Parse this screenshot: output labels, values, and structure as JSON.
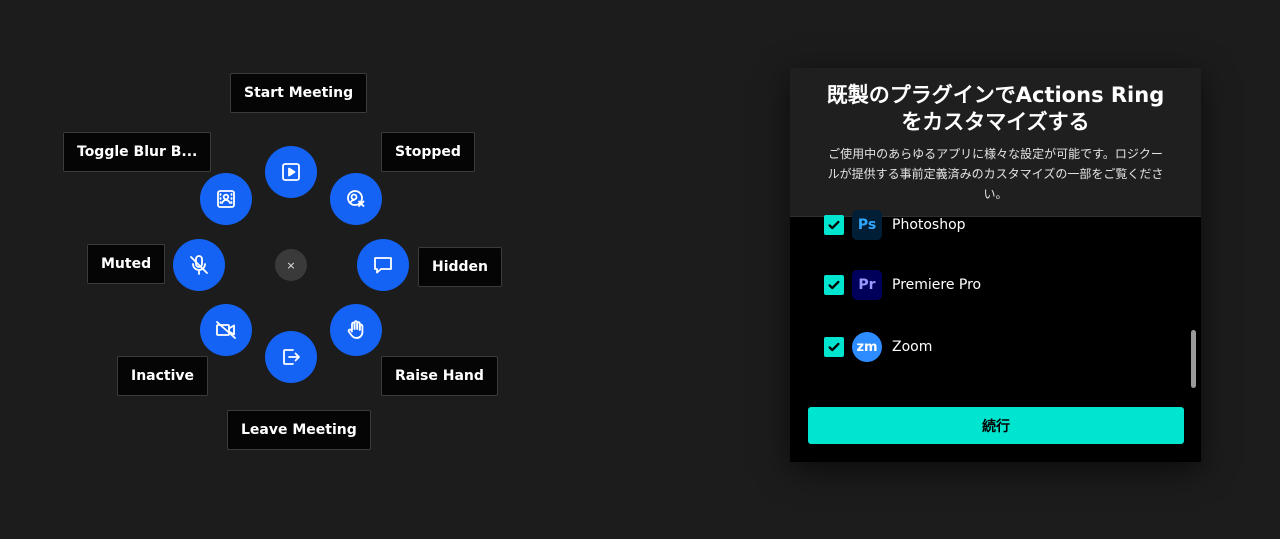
{
  "ring": {
    "labels": {
      "top": "Start Meeting",
      "top_right": "Stopped",
      "right": "Hidden",
      "bottom_right": "Raise Hand",
      "bottom": "Leave Meeting",
      "bottom_left": "Inactive",
      "left": "Muted",
      "top_left": "Toggle Blur B..."
    },
    "center_glyph": "×",
    "button_color": "#1463f5"
  },
  "panel": {
    "title": "既製のプラグインでActions Ringをカスタマイズする",
    "description": "ご使用中のあらゆるアプリに様々な設定が可能です。ロジクールが提供する事前定義済みのカスタマイズの一部をご覧ください。",
    "apps": [
      {
        "name": "Photoshop",
        "icon_text": "Ps",
        "checked": true
      },
      {
        "name": "Premiere Pro",
        "icon_text": "Pr",
        "checked": true
      },
      {
        "name": "Zoom",
        "icon_text": "zm",
        "checked": true
      }
    ],
    "continue_label": "続行",
    "accent_color": "#00e5d0"
  }
}
